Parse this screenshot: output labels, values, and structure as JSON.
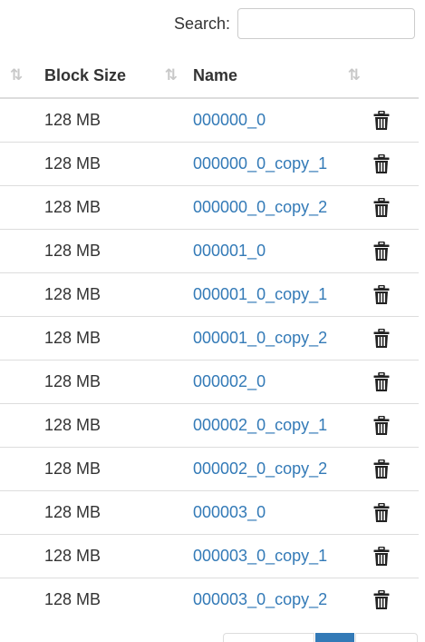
{
  "search": {
    "label": "Search:",
    "value": "",
    "placeholder": ""
  },
  "table": {
    "columns": [
      {
        "label": "",
        "sort_icon": "sort-icon"
      },
      {
        "label": "Block Size",
        "sort_icon": "sort-icon"
      },
      {
        "label": "Name",
        "sort_icon": "sort-icon"
      },
      {
        "label": ""
      }
    ],
    "rows": [
      {
        "block_size": "128 MB",
        "name": "000000_0",
        "action_icon": "trash-icon"
      },
      {
        "block_size": "128 MB",
        "name": "000000_0_copy_1",
        "action_icon": "trash-icon"
      },
      {
        "block_size": "128 MB",
        "name": "000000_0_copy_2",
        "action_icon": "trash-icon"
      },
      {
        "block_size": "128 MB",
        "name": "000001_0",
        "action_icon": "trash-icon"
      },
      {
        "block_size": "128 MB",
        "name": "000001_0_copy_1",
        "action_icon": "trash-icon"
      },
      {
        "block_size": "128 MB",
        "name": "000001_0_copy_2",
        "action_icon": "trash-icon"
      },
      {
        "block_size": "128 MB",
        "name": "000002_0",
        "action_icon": "trash-icon"
      },
      {
        "block_size": "128 MB",
        "name": "000002_0_copy_1",
        "action_icon": "trash-icon"
      },
      {
        "block_size": "128 MB",
        "name": "000002_0_copy_2",
        "action_icon": "trash-icon"
      },
      {
        "block_size": "128 MB",
        "name": "000003_0",
        "action_icon": "trash-icon"
      },
      {
        "block_size": "128 MB",
        "name": "000003_0_copy_1",
        "action_icon": "trash-icon"
      },
      {
        "block_size": "128 MB",
        "name": "000003_0_copy_2",
        "action_icon": "trash-icon"
      }
    ]
  },
  "colors": {
    "link": "#337ab7",
    "border": "#dddddd",
    "sort_icon": "#c8c8c8",
    "trash": "#222222",
    "pager_active": "#337ab7"
  }
}
